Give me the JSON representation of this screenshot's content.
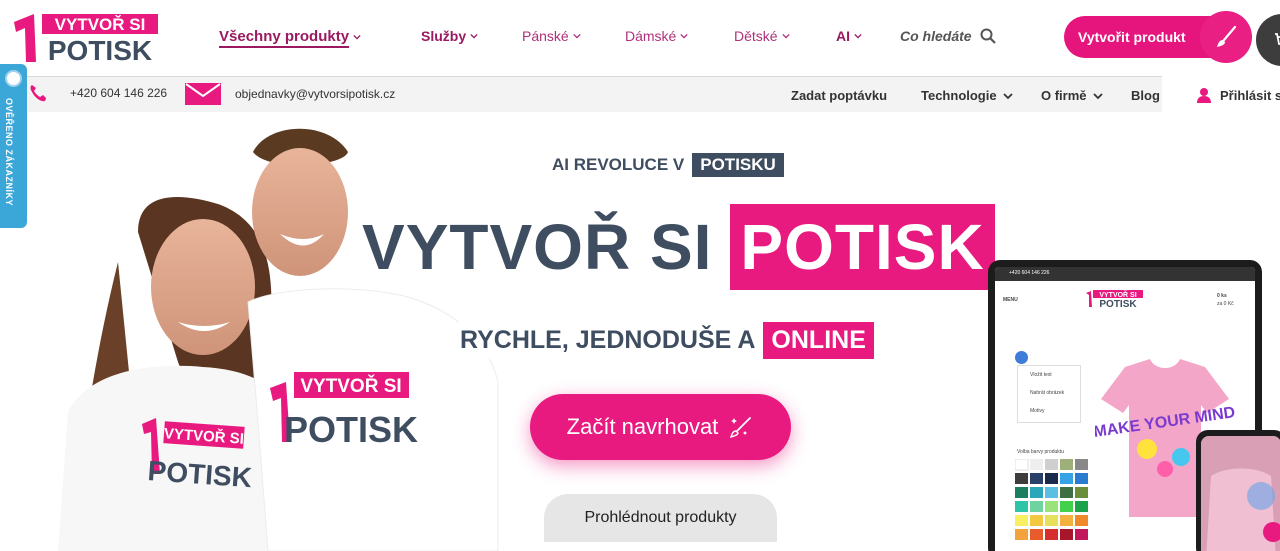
{
  "brand": {
    "logo_line1": "VYTVOŘ SI",
    "logo_line2": "POTISK",
    "logo_digit": "1",
    "pink": "#e8197f",
    "dark": "#3e4d60"
  },
  "nav": {
    "items": [
      {
        "label": "Všechny produkty"
      },
      {
        "label": "Služby"
      },
      {
        "label": "Pánské"
      },
      {
        "label": "Dámské"
      },
      {
        "label": "Dětské"
      },
      {
        "label": "AI"
      }
    ],
    "search_label": "Co hledáte",
    "create_button": "Vytvořit produkt"
  },
  "subbar": {
    "phone": "+420 604 146 226",
    "email": "objednavky@vytvorsipotisk.cz",
    "links": [
      {
        "label": "Zadat poptávku"
      },
      {
        "label": "Technologie"
      },
      {
        "label": "O firmě"
      },
      {
        "label": "Blog"
      }
    ],
    "login": "Přihlásit s"
  },
  "verified_tab": "OVĚŘENO ZÁKAZNÍKY",
  "hero": {
    "eyebrow_text": "AI REVOLUCE V",
    "eyebrow_box": "POTISKU",
    "title_dark": "VYTVOŘ SI",
    "title_pink": "POTISK",
    "subtitle_dark": "RYCHLE, JEDNODUŠE A",
    "subtitle_pink": "ONLINE",
    "cta_primary": "Začít navrhovat",
    "cta_secondary": "Prohlédnout produkty"
  },
  "tshirt_print": {
    "line1": "VYTVOŘ SI",
    "line2": "POTISK",
    "digit": "1"
  },
  "tablet": {
    "top_phone": "+420 604 146 226",
    "menu_label": "MENU",
    "cart_qty": "0 ks",
    "cart_price": "za 0 Kč",
    "tools": [
      {
        "label": "Vložit text"
      },
      {
        "label": "Nahrát obrázek"
      },
      {
        "label": "Motivy"
      }
    ],
    "colors_label": "Volba barvy produktu",
    "shirt_text": "MAKE YOUR MIND"
  }
}
